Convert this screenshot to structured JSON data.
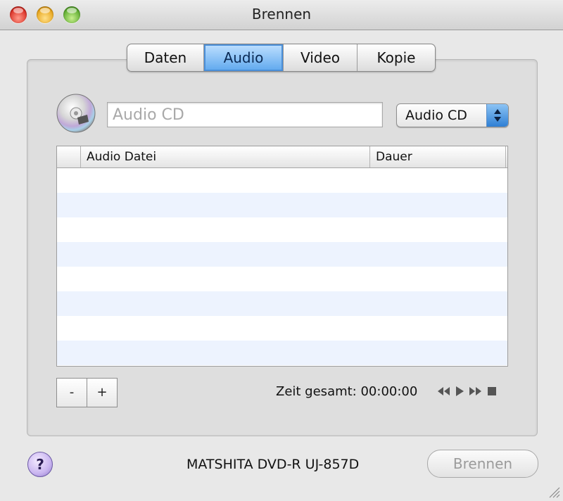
{
  "window": {
    "title": "Brennen"
  },
  "tabs": [
    {
      "label": "Daten",
      "active": false
    },
    {
      "label": "Audio",
      "active": true
    },
    {
      "label": "Video",
      "active": false
    },
    {
      "label": "Kopie",
      "active": false
    }
  ],
  "disc_name": {
    "placeholder": "Audio CD",
    "value": ""
  },
  "format_popup": {
    "selected": "Audio CD"
  },
  "table": {
    "columns": [
      "",
      "Audio Datei",
      "Dauer"
    ],
    "rows": []
  },
  "buttons": {
    "remove": "-",
    "add": "+",
    "burn": "Brennen",
    "help": "?"
  },
  "total_time": "Zeit gesamt: 00:00:00",
  "drive_name": "MATSHITA DVD-R UJ-857D",
  "icons": [
    "disc-icon",
    "rewind-icon",
    "play-icon",
    "fast-forward-icon",
    "stop-icon",
    "help-icon",
    "resize-grip-icon"
  ]
}
